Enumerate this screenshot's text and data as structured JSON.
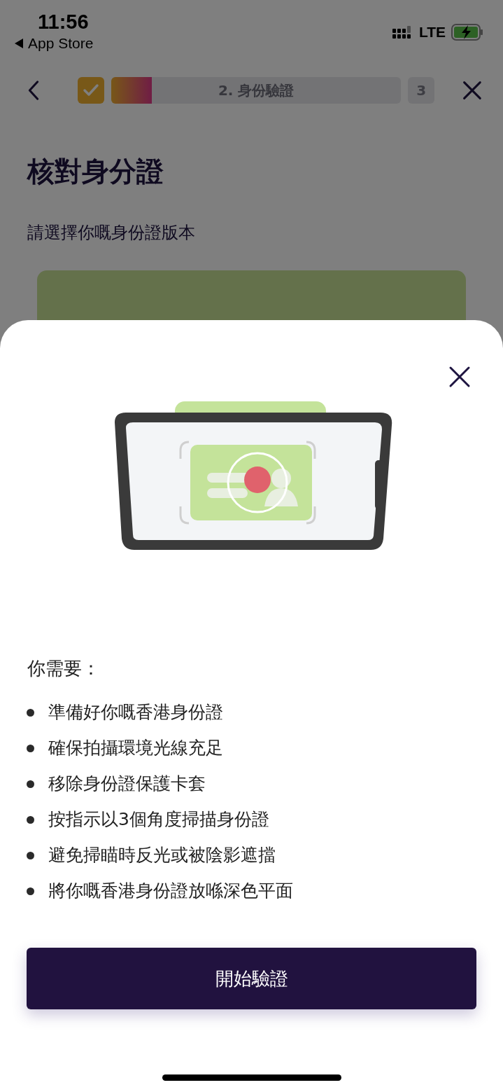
{
  "status_bar": {
    "time": "11:56",
    "back_app": "App Store",
    "network": "LTE"
  },
  "nav": {
    "steps": [
      {
        "kind": "done",
        "checked": true
      },
      {
        "kind": "progress",
        "label": "2. 身份驗證",
        "level": 0.14
      },
      {
        "kind": "pending",
        "label": "3"
      }
    ]
  },
  "page": {
    "title": "核對身分證",
    "subtitle": "請選擇你嘅身份證版本"
  },
  "sheet": {
    "heading": "你需要：",
    "items": [
      "準備好你嘅香港身份證",
      "確保拍攝環境光線充足",
      "移除身份證保護卡套",
      "按指示以3個角度掃描身份證",
      "避免掃瞄時反光或被陰影遮擋",
      "將你嘅香港身份證放喺深色平面"
    ],
    "button": "開始驗證"
  }
}
